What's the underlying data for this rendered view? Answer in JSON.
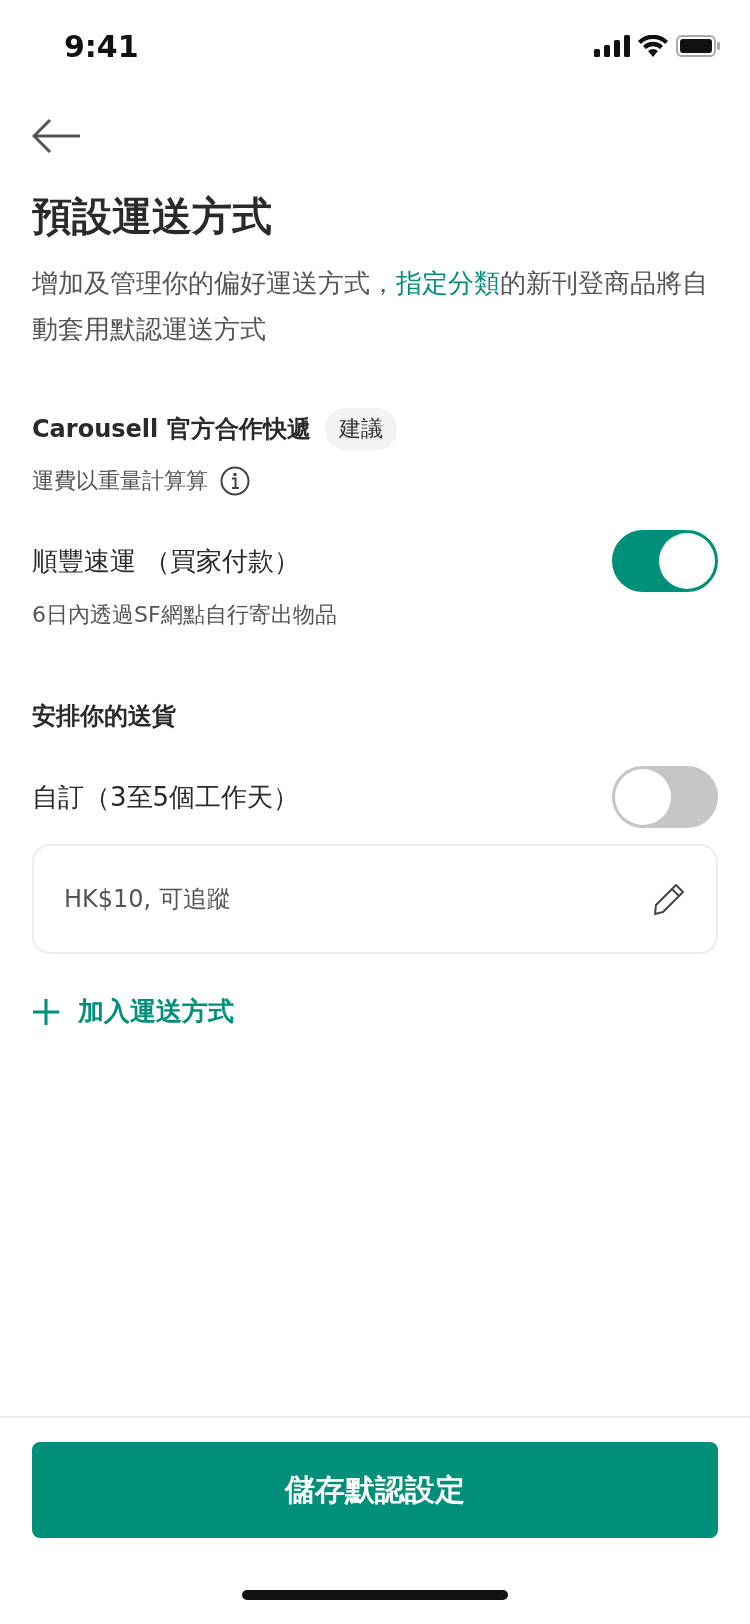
{
  "status_bar": {
    "time": "9:41"
  },
  "title": "預設運送方式",
  "description": [
    {
      "kind": "text",
      "text": "增加及管理你的偏好運送方式，"
    },
    {
      "kind": "link",
      "text": "指定分類"
    },
    {
      "kind": "text",
      "text": "的新刊登商品將自動套用默認運送方式"
    }
  ],
  "sections": [
    {
      "heading": "Carousell 官方合作快遞",
      "badge": "建議",
      "note": "運費以重量計算算",
      "options": [
        {
          "label": "順豐速運 （買家付款）",
          "sublabel": "6日內透過SF網點自行寄出物品",
          "on": true
        }
      ]
    },
    {
      "heading": "安排你的送貨",
      "options": [
        {
          "label": "自訂（3至5個工作天）",
          "on": false,
          "detail": "HK$10, 可追蹤"
        }
      ]
    }
  ],
  "add_link": "加入運送方式",
  "save_button": "儲存默認設定"
}
